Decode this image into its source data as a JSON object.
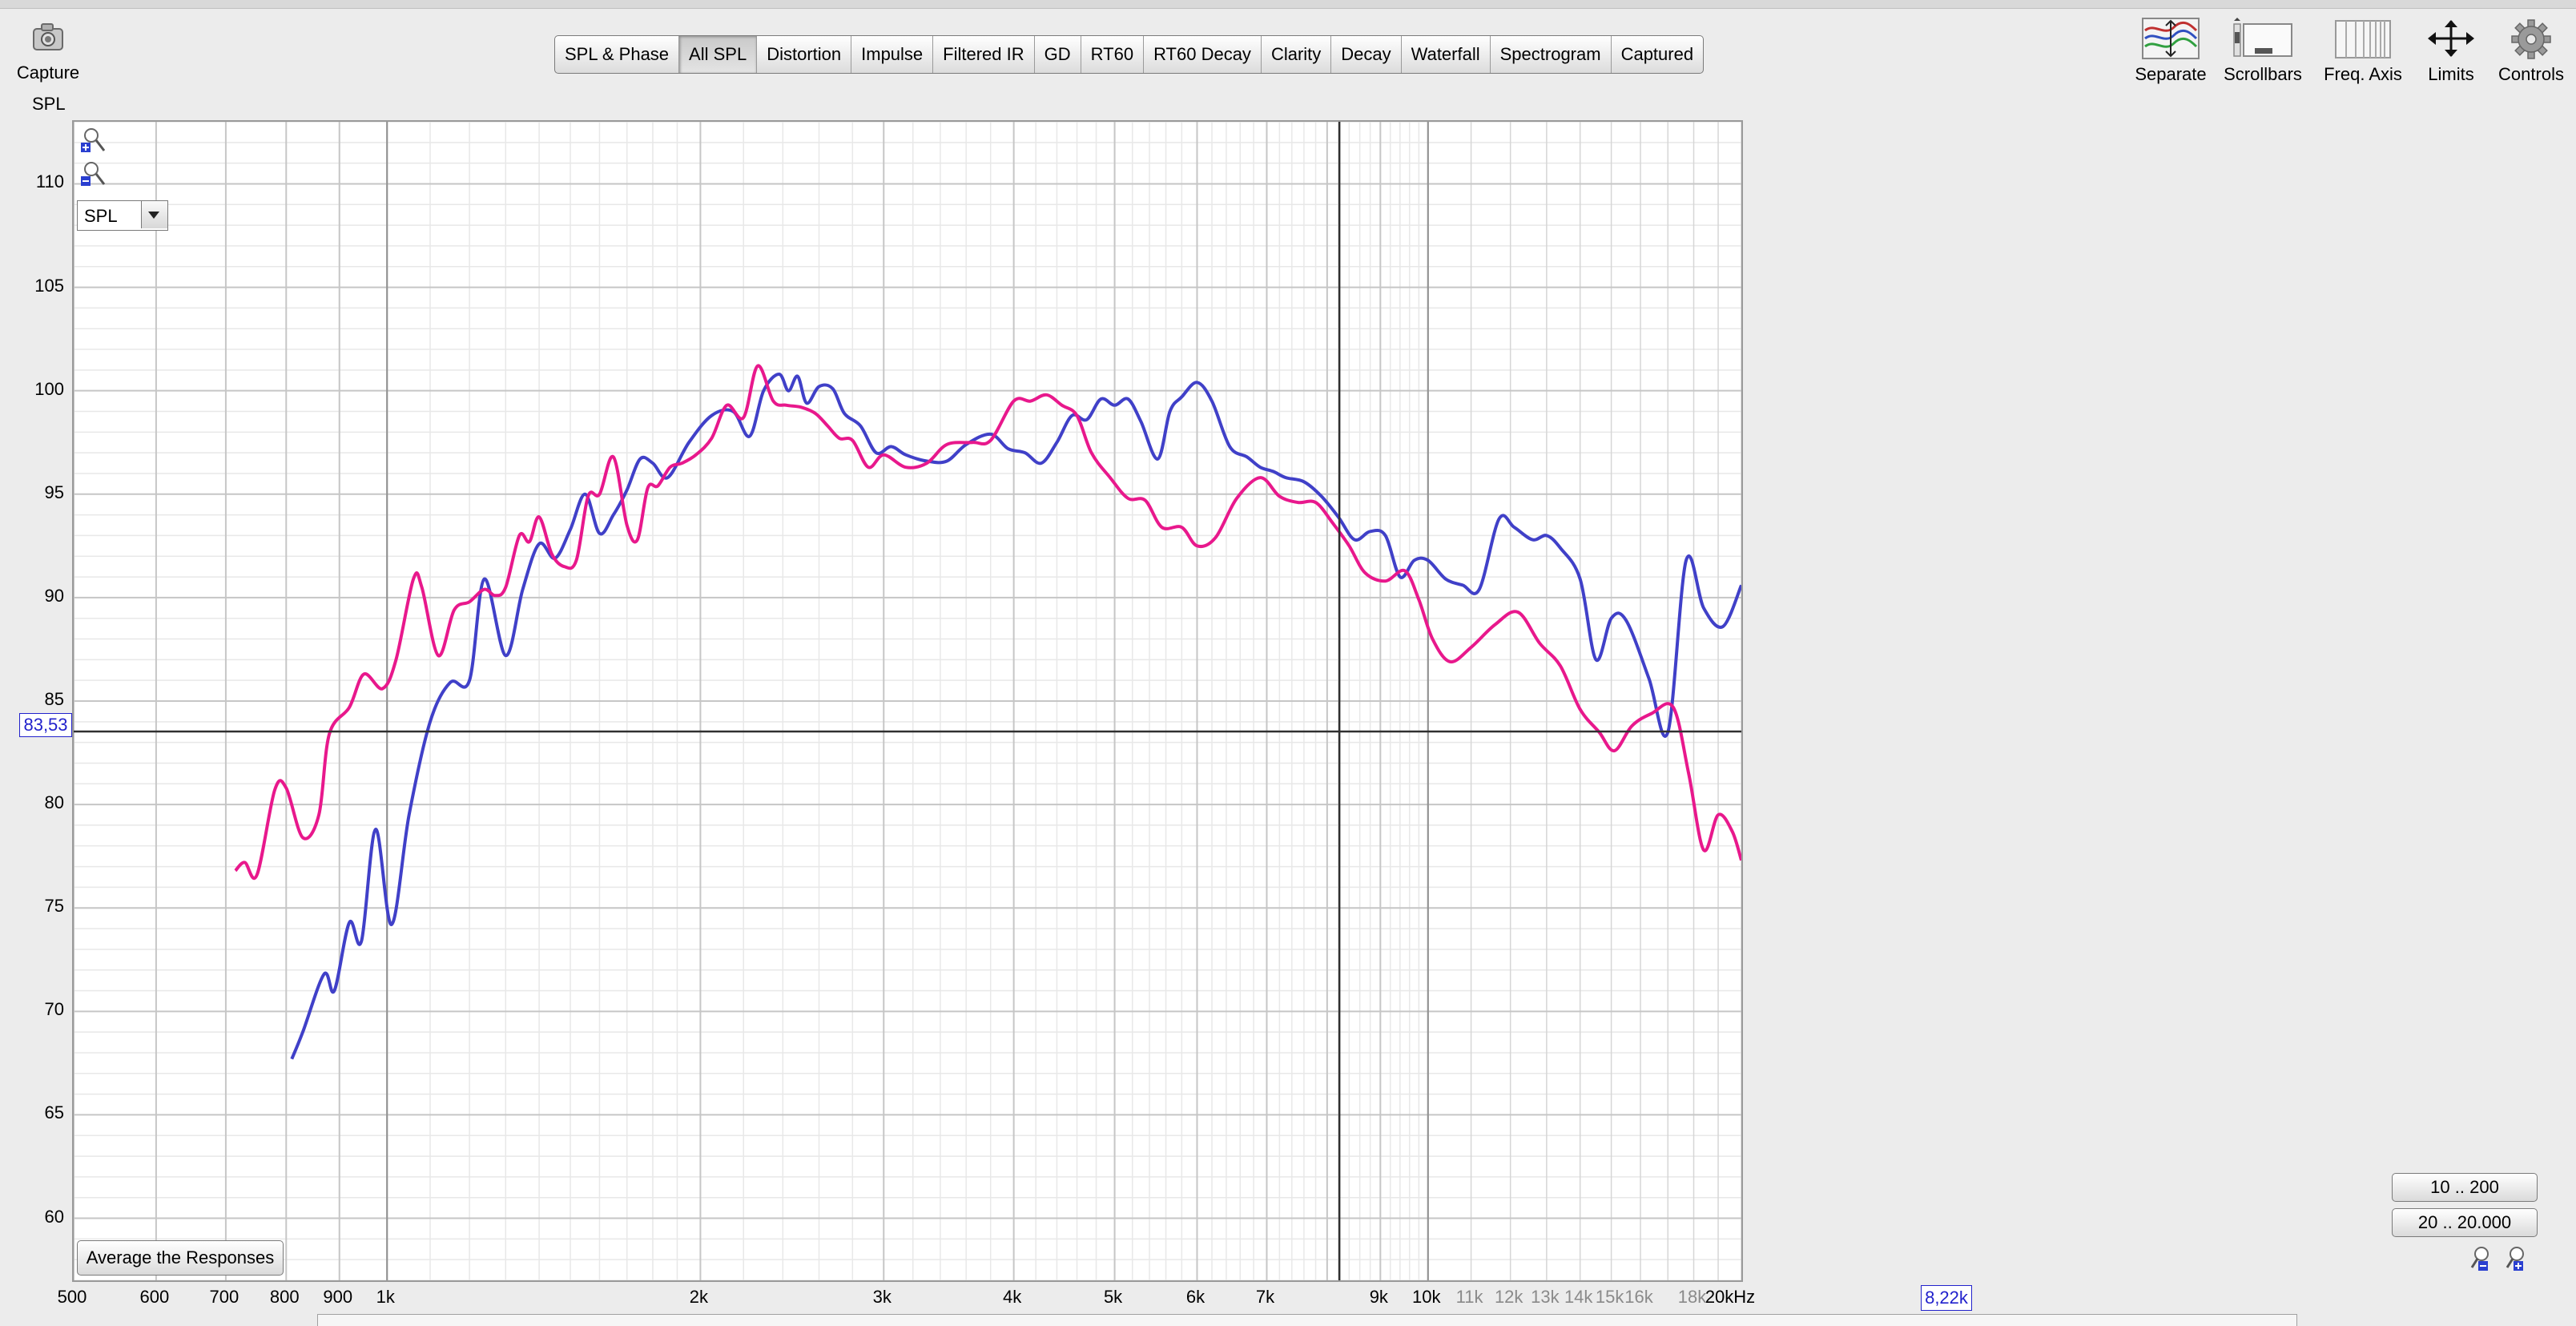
{
  "toolbar": {
    "capture_label": "Capture",
    "spl_axis_title": "SPL",
    "tabs": [
      {
        "label": "SPL & Phase",
        "active": false
      },
      {
        "label": "All SPL",
        "active": true
      },
      {
        "label": "Distortion",
        "active": false
      },
      {
        "label": "Impulse",
        "active": false
      },
      {
        "label": "Filtered IR",
        "active": false
      },
      {
        "label": "GD",
        "active": false
      },
      {
        "label": "RT60",
        "active": false
      },
      {
        "label": "RT60 Decay",
        "active": false
      },
      {
        "label": "Clarity",
        "active": false
      },
      {
        "label": "Decay",
        "active": false
      },
      {
        "label": "Waterfall",
        "active": false
      },
      {
        "label": "Spectrogram",
        "active": false
      },
      {
        "label": "Captured",
        "active": false
      }
    ],
    "tools": {
      "separate": "Separate",
      "scrollbars": "Scrollbars",
      "freq_axis": "Freq. Axis",
      "limits": "Limits",
      "controls": "Controls"
    }
  },
  "graph": {
    "dataset_select": "SPL",
    "average_button": "Average the Responses",
    "range_buttons": [
      "10 .. 200",
      "20 .. 20.000"
    ],
    "cursor_y_readout": "83,53",
    "cursor_x_readout": "8,22k",
    "colors": {
      "trace1": "#4040c8",
      "trace2": "#e8188c",
      "cursor": "#303030",
      "grid_major": "#c6c6c6",
      "grid_minor": "#e8e8e8"
    }
  },
  "chart_data": {
    "type": "line",
    "xlabel": "",
    "ylabel": "SPL",
    "x_scale": "log",
    "xlim": [
      500,
      20000
    ],
    "ylim": [
      57,
      113
    ],
    "y_tick_labels": [
      "110",
      "105",
      "100",
      "95",
      "90",
      "85",
      "80",
      "75",
      "70",
      "65",
      "60"
    ],
    "x_tick_labels": [
      {
        "f": 500,
        "label": "500",
        "minor": false
      },
      {
        "f": 600,
        "label": "600",
        "minor": false
      },
      {
        "f": 700,
        "label": "700",
        "minor": false
      },
      {
        "f": 800,
        "label": "800",
        "minor": false
      },
      {
        "f": 900,
        "label": "900",
        "minor": false
      },
      {
        "f": 1000,
        "label": "1k",
        "minor": false
      },
      {
        "f": 2000,
        "label": "2k",
        "minor": false
      },
      {
        "f": 3000,
        "label": "3k",
        "minor": false
      },
      {
        "f": 4000,
        "label": "4k",
        "minor": false
      },
      {
        "f": 5000,
        "label": "5k",
        "minor": false
      },
      {
        "f": 6000,
        "label": "6k",
        "minor": false
      },
      {
        "f": 7000,
        "label": "7k",
        "minor": false
      },
      {
        "f": 9000,
        "label": "9k",
        "minor": false
      },
      {
        "f": 10000,
        "label": "10k",
        "minor": false
      },
      {
        "f": 11000,
        "label": "11k",
        "minor": true
      },
      {
        "f": 12000,
        "label": "12k",
        "minor": true
      },
      {
        "f": 13000,
        "label": "13k",
        "minor": true
      },
      {
        "f": 14000,
        "label": "14k",
        "minor": true
      },
      {
        "f": 15000,
        "label": "15k",
        "minor": true
      },
      {
        "f": 16000,
        "label": "16k",
        "minor": true
      },
      {
        "f": 18000,
        "label": "18k",
        "minor": true
      },
      {
        "f": 20000,
        "label": "20kHz",
        "minor": false
      }
    ],
    "grid": true,
    "cursor": {
      "x": 8220,
      "y": 83.53
    },
    "series": [
      {
        "color": "#4040c8",
        "points": [
          [
            810,
            67.7
          ],
          [
            830,
            69
          ],
          [
            870,
            71.8
          ],
          [
            890,
            71
          ],
          [
            920,
            74.3
          ],
          [
            945,
            73.4
          ],
          [
            975,
            78.8
          ],
          [
            1010,
            74.2
          ],
          [
            1050,
            79.5
          ],
          [
            1100,
            84
          ],
          [
            1150,
            85.9
          ],
          [
            1200,
            86
          ],
          [
            1240,
            90.9
          ],
          [
            1300,
            87.2
          ],
          [
            1350,
            90.4
          ],
          [
            1400,
            92.6
          ],
          [
            1450,
            91.9
          ],
          [
            1500,
            93.3
          ],
          [
            1550,
            95
          ],
          [
            1600,
            93.1
          ],
          [
            1650,
            94
          ],
          [
            1700,
            95.2
          ],
          [
            1750,
            96.7
          ],
          [
            1800,
            96.5
          ],
          [
            1860,
            95.8
          ],
          [
            1950,
            97.5
          ],
          [
            2050,
            98.8
          ],
          [
            2150,
            99
          ],
          [
            2230,
            97.8
          ],
          [
            2300,
            100
          ],
          [
            2380,
            100.8
          ],
          [
            2430,
            100
          ],
          [
            2480,
            100.7
          ],
          [
            2530,
            99.4
          ],
          [
            2600,
            100.2
          ],
          [
            2680,
            100.1
          ],
          [
            2750,
            98.9
          ],
          [
            2850,
            98.3
          ],
          [
            2950,
            97
          ],
          [
            3050,
            97.3
          ],
          [
            3150,
            96.9
          ],
          [
            3300,
            96.6
          ],
          [
            3450,
            96.6
          ],
          [
            3600,
            97.4
          ],
          [
            3800,
            97.9
          ],
          [
            3950,
            97.2
          ],
          [
            4100,
            97
          ],
          [
            4250,
            96.5
          ],
          [
            4400,
            97.5
          ],
          [
            4550,
            98.8
          ],
          [
            4700,
            98.6
          ],
          [
            4850,
            99.6
          ],
          [
            5000,
            99.3
          ],
          [
            5150,
            99.6
          ],
          [
            5300,
            98.5
          ],
          [
            5500,
            96.7
          ],
          [
            5650,
            99
          ],
          [
            5800,
            99.7
          ],
          [
            6000,
            100.4
          ],
          [
            6200,
            99.5
          ],
          [
            6450,
            97.3
          ],
          [
            6700,
            96.8
          ],
          [
            6900,
            96.3
          ],
          [
            7100,
            96.1
          ],
          [
            7300,
            95.8
          ],
          [
            7600,
            95.6
          ],
          [
            7900,
            94.9
          ],
          [
            8200,
            93.9
          ],
          [
            8500,
            92.8
          ],
          [
            8800,
            93.2
          ],
          [
            9100,
            93
          ],
          [
            9400,
            91
          ],
          [
            9700,
            91.8
          ],
          [
            10000,
            91.8
          ],
          [
            10400,
            90.9
          ],
          [
            10800,
            90.6
          ],
          [
            11200,
            90.4
          ],
          [
            11700,
            93.8
          ],
          [
            12100,
            93.4
          ],
          [
            12600,
            92.8
          ],
          [
            13000,
            93
          ],
          [
            13400,
            92.4
          ],
          [
            14000,
            90.9
          ],
          [
            14500,
            87
          ],
          [
            15000,
            89
          ],
          [
            15500,
            88.9
          ],
          [
            16300,
            86.1
          ],
          [
            17000,
            83.5
          ],
          [
            17700,
            91.8
          ],
          [
            18400,
            89.5
          ],
          [
            19200,
            88.6
          ],
          [
            20000,
            90.6
          ]
        ]
      },
      {
        "color": "#e8188c",
        "points": [
          [
            715,
            76.8
          ],
          [
            730,
            77.2
          ],
          [
            750,
            76.6
          ],
          [
            780,
            80.7
          ],
          [
            800,
            80.8
          ],
          [
            830,
            78.4
          ],
          [
            860,
            79.5
          ],
          [
            880,
            83.4
          ],
          [
            920,
            84.7
          ],
          [
            950,
            86.3
          ],
          [
            990,
            85.6
          ],
          [
            1020,
            87
          ],
          [
            1060,
            90.9
          ],
          [
            1080,
            90.5
          ],
          [
            1120,
            87.2
          ],
          [
            1160,
            89.4
          ],
          [
            1200,
            89.8
          ],
          [
            1240,
            90.4
          ],
          [
            1270,
            90.1
          ],
          [
            1300,
            90.5
          ],
          [
            1340,
            93
          ],
          [
            1370,
            92.7
          ],
          [
            1400,
            93.9
          ],
          [
            1440,
            92.1
          ],
          [
            1480,
            91.5
          ],
          [
            1520,
            91.8
          ],
          [
            1560,
            94.9
          ],
          [
            1600,
            95
          ],
          [
            1650,
            96.8
          ],
          [
            1700,
            93.5
          ],
          [
            1740,
            92.8
          ],
          [
            1780,
            95.3
          ],
          [
            1820,
            95.4
          ],
          [
            1870,
            96.3
          ],
          [
            1920,
            96.5
          ],
          [
            1980,
            96.9
          ],
          [
            2050,
            97.7
          ],
          [
            2120,
            99.3
          ],
          [
            2200,
            98.7
          ],
          [
            2270,
            101.2
          ],
          [
            2350,
            99.5
          ],
          [
            2420,
            99.3
          ],
          [
            2500,
            99.2
          ],
          [
            2580,
            98.9
          ],
          [
            2650,
            98.3
          ],
          [
            2720,
            97.7
          ],
          [
            2800,
            97.6
          ],
          [
            2900,
            96.3
          ],
          [
            3000,
            96.9
          ],
          [
            3150,
            96.3
          ],
          [
            3300,
            96.5
          ],
          [
            3450,
            97.4
          ],
          [
            3650,
            97.5
          ],
          [
            3800,
            97.6
          ],
          [
            4000,
            99.5
          ],
          [
            4150,
            99.5
          ],
          [
            4300,
            99.8
          ],
          [
            4450,
            99.3
          ],
          [
            4600,
            98.8
          ],
          [
            4750,
            97
          ],
          [
            4950,
            95.8
          ],
          [
            5150,
            94.8
          ],
          [
            5350,
            94.7
          ],
          [
            5550,
            93.4
          ],
          [
            5800,
            93.4
          ],
          [
            6000,
            92.5
          ],
          [
            6250,
            92.9
          ],
          [
            6550,
            94.8
          ],
          [
            6900,
            95.8
          ],
          [
            7200,
            94.9
          ],
          [
            7500,
            94.6
          ],
          [
            7800,
            94.6
          ],
          [
            8100,
            93.6
          ],
          [
            8400,
            92.5
          ],
          [
            8700,
            91.2
          ],
          [
            9100,
            90.8
          ],
          [
            9500,
            91.3
          ],
          [
            9800,
            89.9
          ],
          [
            10100,
            88
          ],
          [
            10500,
            86.9
          ],
          [
            11000,
            87.6
          ],
          [
            11600,
            88.7
          ],
          [
            12200,
            89.3
          ],
          [
            12800,
            87.8
          ],
          [
            13400,
            86.7
          ],
          [
            14000,
            84.6
          ],
          [
            14600,
            83.5
          ],
          [
            15100,
            82.6
          ],
          [
            15700,
            83.8
          ],
          [
            16400,
            84.4
          ],
          [
            17200,
            84.7
          ],
          [
            17800,
            81.5
          ],
          [
            18400,
            77.8
          ],
          [
            19000,
            79.5
          ],
          [
            19600,
            78.7
          ],
          [
            20000,
            77.3
          ]
        ]
      }
    ]
  }
}
